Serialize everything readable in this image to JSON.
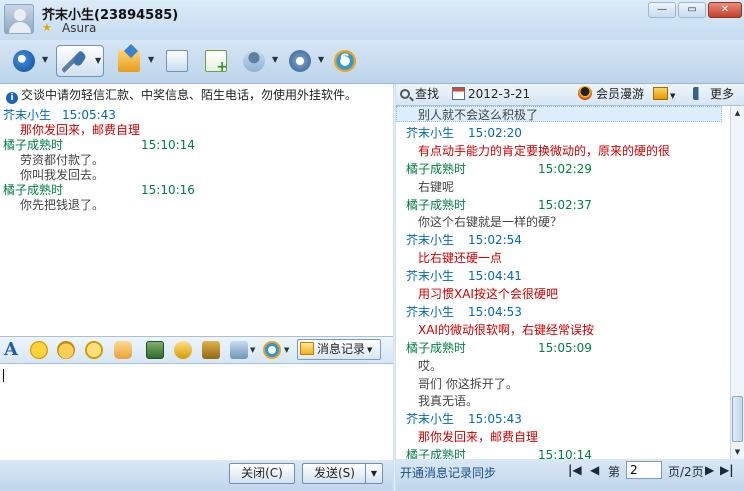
{
  "window": {
    "contact_name": "芥末小生(23894585)",
    "contact_signature": "Asura",
    "minimize_glyph": "—",
    "maximize_glyph": "▭",
    "close_glyph": "✕"
  },
  "toolbar": {
    "items": [
      "video-chat-icon",
      "voice-chat-icon",
      "send-file-icon",
      "send-mail-icon",
      "create-doc-icon",
      "multi-person-meeting-icon",
      "application-icon",
      "soso-search-icon"
    ],
    "dropdown_glyph": "▼"
  },
  "notice": {
    "info_glyph": "i",
    "text": "交谈中请勿轻信汇款、中奖信息、陌生电话，勿使用外挂软件。"
  },
  "left_chat": [
    {
      "sender": "芥末小生",
      "time": "15:05:43",
      "sender_kind": "peer",
      "lines": [
        {
          "text": "那你发回来，邮费自理",
          "color": "red"
        }
      ]
    },
    {
      "sender": "橘子成熟时",
      "time": "15:10:14",
      "sender_kind": "me",
      "lines": [
        {
          "text": "劳资都付款了。",
          "color": "gray"
        },
        {
          "text": "你叫我发回去。",
          "color": "gray"
        }
      ]
    },
    {
      "sender": "橘子成熟时",
      "time": "15:10:16",
      "sender_kind": "me",
      "lines": [
        {
          "text": "你先把钱退了。",
          "color": "gray"
        }
      ]
    }
  ],
  "format_bar": {
    "font_glyph": "A",
    "dropdown_glyph": "▼",
    "history_label": "消息记录"
  },
  "input": {
    "value": ""
  },
  "buttons": {
    "close_label": "关闭(C)",
    "send_label": "发送(S)",
    "send_arrow": "▼"
  },
  "right_toolbar": {
    "find_label": "查找",
    "date": "2012-3-21",
    "roam_label": "会员漫游",
    "more_label": "更多",
    "dropdown_glyph": "▼"
  },
  "right_chat": [
    {
      "type": "text",
      "text": "别人就不会这么积极了",
      "color": "gray"
    },
    {
      "type": "head",
      "sender": "芥末小生",
      "time": "15:02:20",
      "sender_kind": "peer"
    },
    {
      "type": "text",
      "text": "有点动手能力的肯定要换微动的，原来的硬的很",
      "color": "red"
    },
    {
      "type": "head",
      "sender": "橘子成熟时",
      "time": "15:02:29",
      "sender_kind": "me"
    },
    {
      "type": "text",
      "text": "右键呢",
      "color": "gray"
    },
    {
      "type": "head",
      "sender": "橘子成熟时",
      "time": "15:02:37",
      "sender_kind": "me"
    },
    {
      "type": "text",
      "text": "你这个右键就是一样的硬？",
      "color": "gray"
    },
    {
      "type": "head",
      "sender": "芥末小生",
      "time": "15:02:54",
      "sender_kind": "peer"
    },
    {
      "type": "text",
      "text": "比右键还硬一点",
      "color": "red"
    },
    {
      "type": "head",
      "sender": "芥末小生",
      "time": "15:04:41",
      "sender_kind": "peer"
    },
    {
      "type": "text",
      "text": "用习惯XAI按这个会很硬吧",
      "color": "red"
    },
    {
      "type": "head",
      "sender": "芥末小生",
      "time": "15:04:53",
      "sender_kind": "peer"
    },
    {
      "type": "text",
      "text": "XAI的微动很软啊，右键经常误按",
      "color": "red"
    },
    {
      "type": "head",
      "sender": "橘子成熟时",
      "time": "15:05:09",
      "sender_kind": "me"
    },
    {
      "type": "text",
      "text": "哎。",
      "color": "gray"
    },
    {
      "type": "text",
      "text": "哥们 你这拆开了。",
      "color": "gray"
    },
    {
      "type": "text",
      "text": "我真无语。",
      "color": "gray"
    },
    {
      "type": "head",
      "sender": "芥末小生",
      "time": "15:05:43",
      "sender_kind": "peer"
    },
    {
      "type": "text",
      "text": "那你发回来，邮费自理",
      "color": "red"
    },
    {
      "type": "head",
      "sender": "橘子成熟时",
      "time": "15:10:14",
      "sender_kind": "me"
    }
  ],
  "scrollbar": {
    "up_glyph": "▲",
    "down_glyph": "▼"
  },
  "pager": {
    "sync_label": "开通消息记录同步",
    "first_glyph": "|◀",
    "prev_glyph": "◀",
    "page_label": "第",
    "current_page": "2",
    "total_label": "页/2页",
    "next_glyph": "▶",
    "last_glyph": "▶|"
  },
  "colors": {
    "peer_name": "#006ab8",
    "me_name": "#008040",
    "red_text": "#d00000",
    "gray_text": "#444444"
  }
}
